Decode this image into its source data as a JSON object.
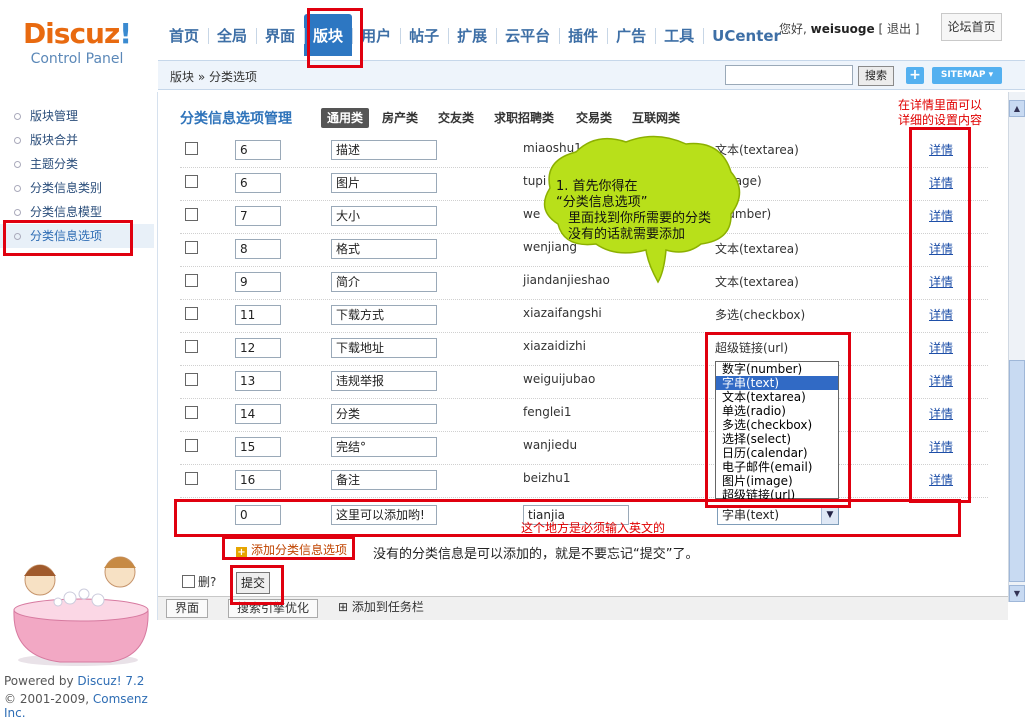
{
  "app": {
    "logo_main": "Discuz",
    "logo_mark": "!",
    "logo_sub": "Control Panel"
  },
  "nav": {
    "tabs": [
      "首页",
      "全局",
      "界面",
      "版块",
      "用户",
      "帖子",
      "扩展",
      "云平台",
      "插件",
      "广告",
      "工具",
      "UCenter"
    ],
    "active": "版块"
  },
  "user": {
    "greeting": "您好,",
    "name": "weisuoge",
    "logout": "[ 退出 ]",
    "forum_home": "论坛首页"
  },
  "breadcrumb": "版块 » 分类选项",
  "search": {
    "button": "搜索",
    "value": ""
  },
  "toolbar": {
    "plus": "+",
    "sitemap": "SITEMAP ▾"
  },
  "sidebar": {
    "items": [
      "版块管理",
      "版块合并",
      "主题分类",
      "分类信息类别",
      "分类信息模型",
      "分类信息选项"
    ],
    "active": "分类信息选项"
  },
  "footer": {
    "powered": "Powered by ",
    "powered_brand": "Discuz! 7.2",
    "copyright": "© 2001-2009, ",
    "company": "Comsenz Inc."
  },
  "main": {
    "title": "分类信息选项管理",
    "category_tabs": [
      "通用类",
      "房产类",
      "交友类",
      "求职招聘类",
      "交易类",
      "互联网类"
    ],
    "active_tab": "通用类",
    "rows": [
      {
        "order": "6",
        "name": "描述",
        "identifier": "miaoshu1",
        "type": "文本(textarea)",
        "detail": "详情"
      },
      {
        "order": "6",
        "name": "图片",
        "identifier": "tupi",
        "type": "(image)",
        "detail": "详情"
      },
      {
        "order": "7",
        "name": "大小",
        "identifier": "we",
        "type": "(number)",
        "detail": "详情"
      },
      {
        "order": "8",
        "name": "格式",
        "identifier": "wenjiang",
        "type": "文本(textarea)",
        "detail": "详情"
      },
      {
        "order": "9",
        "name": "简介",
        "identifier": "jiandanjieshao",
        "type": "文本(textarea)",
        "detail": "详情"
      },
      {
        "order": "11",
        "name": "下载方式",
        "identifier": "xiazaifangshi",
        "type": "多选(checkbox)",
        "detail": "详情"
      },
      {
        "order": "12",
        "name": "下载地址",
        "identifier": "xiazaidizhi",
        "type": "超级链接(url)",
        "detail": "详情"
      },
      {
        "order": "13",
        "name": "违规举报",
        "identifier": "weiguijubao",
        "type": "",
        "detail": "详情"
      },
      {
        "order": "14",
        "name": "分类",
        "identifier": "fenglei1",
        "type": "",
        "detail": "详情"
      },
      {
        "order": "15",
        "name": "完结°",
        "identifier": "wanjiedu",
        "type": "",
        "detail": "详情"
      },
      {
        "order": "16",
        "name": "备注",
        "identifier": "beizhu1",
        "type": "",
        "detail": "详情"
      }
    ],
    "new_row": {
      "order": "0",
      "name": "这里可以添加哟!",
      "identifier": "tianjia",
      "type": "字串(text)"
    },
    "dropdown_options": [
      "数字(number)",
      "字串(text)",
      "文本(textarea)",
      "单选(radio)",
      "多选(checkbox)",
      "选择(select)",
      "日历(calendar)",
      "电子邮件(email)",
      "图片(image)",
      "超级链接(url)"
    ],
    "dropdown_selected": "字串(text)",
    "add_link": "添加分类信息选项",
    "delete_label": "删?",
    "submit": "提交"
  },
  "annotations": {
    "top_note_line1": "在详情里面可以",
    "top_note_line2": "详细的设置内容",
    "bubble_line1": "1. 首先你得在",
    "bubble_line2": "“分类信息选项”",
    "bubble_line3": "里面找到你所需要的分类",
    "bubble_line4": "没有的话就需要添加",
    "english_note": "这个地方是必须输入英文的",
    "add_note": "没有的分类信息是可以添加的，就是不要忘记“提交”了。"
  },
  "taskbar": {
    "items": [
      "界面",
      "搜索引擎优化",
      "添加到任务栏"
    ]
  },
  "colors": {
    "accent": "#2d77c2",
    "highlight": "#e0000f",
    "bubble": "#b8e01a"
  }
}
